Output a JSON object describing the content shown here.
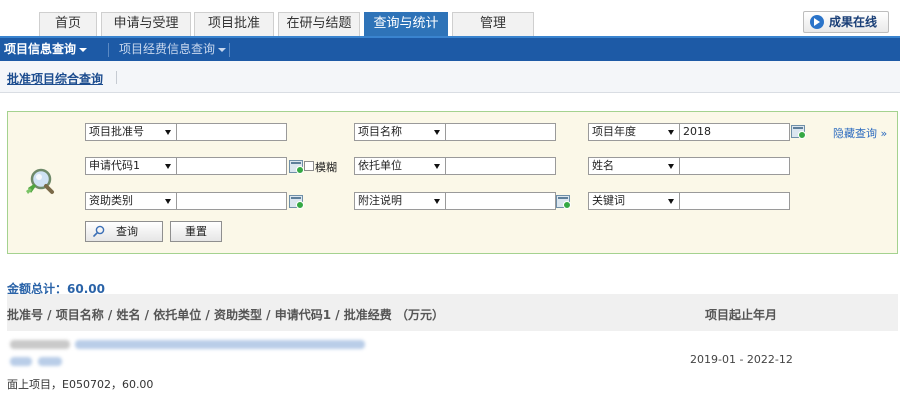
{
  "nav": {
    "tabs": [
      "首页",
      "申请与受理",
      "项目批准",
      "在研与结题",
      "查询与统计",
      "管理"
    ],
    "active_tab": "查询与统计",
    "result_online": "成果在线"
  },
  "submenu": {
    "items": [
      "项目信息查询",
      "项目经费信息查询"
    ]
  },
  "breadcrumb": {
    "label": "批准项目综合查询"
  },
  "query": {
    "rows": [
      [
        {
          "select": "项目批准号",
          "value": ""
        },
        {
          "select": "项目名称",
          "value": ""
        },
        {
          "select": "项目年度",
          "value": "2018"
        }
      ],
      [
        {
          "select": "申请代码1",
          "value": ""
        },
        {
          "select": "依托单位",
          "value": ""
        },
        {
          "select": "姓名",
          "value": ""
        }
      ],
      [
        {
          "select": "资助类别",
          "value": ""
        },
        {
          "select": "附注说明",
          "value": ""
        },
        {
          "select": "关键词",
          "value": ""
        }
      ]
    ],
    "fuzzy_label": "模糊",
    "toggle_label": "隐藏查询 »",
    "search_button": "查询",
    "reset_button": "重置"
  },
  "results": {
    "total": "金额总计：60.00",
    "header_main": "批准号 / 项目名称 / 姓名 / 依托单位 / 资助类型 / 申请代码1 / 批准经费 （万元）",
    "header_dates": "项目起止年月",
    "rows": [
      {
        "detail": "面上项目，E050702，60.00",
        "dates": "2019-01 - 2022-12"
      }
    ]
  },
  "colors": {
    "accent_blue": "#1d5aa6",
    "active_tab": "#2e73b8",
    "panel_bg": "#fbf8e8",
    "panel_border": "#a4d28f"
  }
}
